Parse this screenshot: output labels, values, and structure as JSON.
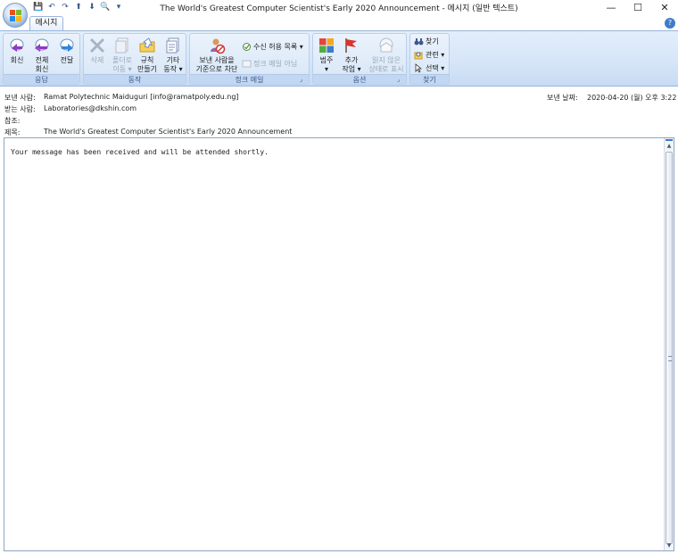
{
  "window": {
    "title": "The World's Greatest Computer Scientist's Early 2020 Announcement - 메시지 (일반 텍스트)",
    "controls": [
      "—",
      "☐",
      "✕"
    ]
  },
  "quick_access": [
    "💾",
    "↶",
    "↷",
    "⬆",
    "⬇",
    "🔍",
    "▾"
  ],
  "tabs": [
    {
      "label": "메시지",
      "active": true
    }
  ],
  "ribbon": {
    "groups": {
      "respond": {
        "label": "응답",
        "reply": "회신",
        "reply_all_1": "전체",
        "reply_all_2": "회신",
        "forward": "전달"
      },
      "actions": {
        "label": "동작",
        "delete": "삭제",
        "move_1": "폴더로",
        "move_2": "이동 ▾",
        "rules_1": "규칙",
        "rules_2": "만들기 ▾",
        "other_1": "기타",
        "other_2": "동작 ▾"
      },
      "junk": {
        "label": "정크 메일",
        "block_1": "보낸 사람을",
        "block_2": "기준으로 차단",
        "safe_list": "수신 허용 목록 ▾",
        "not_junk": "정크 메일 아님"
      },
      "options": {
        "label": "옵션",
        "categorize_1": "범주",
        "categorize_2": "▾",
        "followup_1": "추가",
        "followup_2": "작업 ▾",
        "unread_1": "읽지 않은",
        "unread_2": "상태로 표시"
      },
      "find": {
        "label": "찾기",
        "find": "찾기",
        "related": "관련 ▾",
        "select": "선택 ▾"
      }
    }
  },
  "header": {
    "from_label": "보낸 사람:",
    "from_value": "Ramat Polytechnic Maiduguri [info@ramatpoly.edu.ng]",
    "to_label": "받는 사람:",
    "to_value": "Laboratories@dkshin.com",
    "cc_label": "참조:",
    "cc_value": "",
    "subject_label": "제목:",
    "subject_value": "The World's Greatest Computer Scientist's Early 2020 Announcement",
    "sent_label": "보낸 날짜:",
    "sent_value": "2020-04-20 (월) 오후 3:22"
  },
  "body": {
    "text": "Your message has been received and will be attended shortly."
  },
  "colors": {
    "ribbon_bg": "#d5e5f7",
    "accent": "#3f7cc9"
  }
}
